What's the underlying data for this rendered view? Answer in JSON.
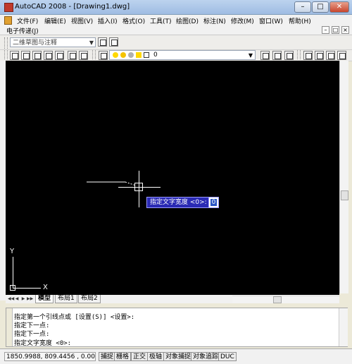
{
  "window": {
    "title": "AutoCAD 2008 - [Drawing1.dwg]",
    "min_label": "–",
    "max_label": "□",
    "close_label": "✕"
  },
  "menu": {
    "items": [
      "文件(F)",
      "编辑(E)",
      "视图(V)",
      "插入(I)",
      "格式(O)",
      "工具(T)",
      "绘图(D)",
      "标注(N)",
      "修改(M)",
      "窗口(W)",
      "帮助(H)"
    ],
    "second_row": "电子传递(J)"
  },
  "toolbar": {
    "workspace": "二维草图与注释",
    "layer_value": "0"
  },
  "canvas": {
    "tooltip_prompt": "指定文字宽度 <0>:",
    "tooltip_value": "0",
    "ucs_y": "Y",
    "ucs_x": "X"
  },
  "layout_tabs": [
    "模型",
    "布局1",
    "布局2"
  ],
  "command_lines": [
    "指定第一个引线点或 [设置(S)] <设置>:",
    "指定下一点:",
    "指定下一点:",
    "指定文字宽度 <0>:"
  ],
  "status": {
    "coords": "1850.9988, 809.4456 , 0.0000",
    "buttons": [
      "捕捉",
      "栅格",
      "正交",
      "极轴",
      "对象捕捉",
      "对象追踪",
      "DUC"
    ]
  },
  "colors": {
    "canvas": "#000000",
    "tooltip": "#2a2ab4",
    "titlebar": "#9fbce3"
  }
}
